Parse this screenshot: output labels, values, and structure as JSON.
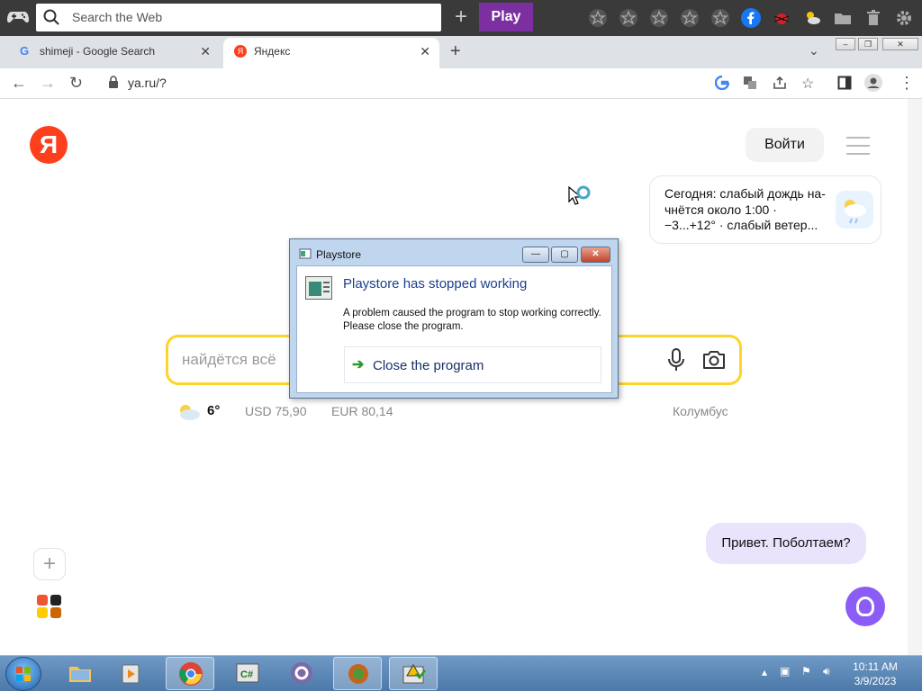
{
  "launcher": {
    "search_placeholder": "Search the Web",
    "new_label": "+",
    "play_label": "Play",
    "toolbar_icons": [
      "star-icon",
      "star-icon",
      "star-icon",
      "star-icon",
      "star-icon",
      "facebook-icon",
      "bug-icon",
      "weather-icon",
      "folder-icon",
      "trash-icon",
      "gear-icon"
    ]
  },
  "browser": {
    "tabs": [
      {
        "title": "shimeji - Google Search",
        "close": "✕",
        "favicon": "G"
      },
      {
        "title": "Яндекс",
        "close": "✕",
        "favicon": "Я"
      }
    ],
    "new_tab": "+",
    "tab_dropdown": "⌄",
    "url": "ya.ru/?"
  },
  "yandex": {
    "logo": "Я",
    "login_button": "Войти",
    "weather_card": "Сегодня: слабый дождь на-чнётся около 1:00 · −3...+12° · слабый ветер...",
    "search_placeholder": "найдётся всё",
    "weather_temp": "6°",
    "usd": "USD 75,90",
    "eur": "EUR 80,14",
    "kolumbus": "Колумбус",
    "alice_bubble": "Привет. Поболтаем?"
  },
  "dialog": {
    "title": "Playstore",
    "heading": "Playstore has stopped working",
    "message": "A problem caused the program to stop working correctly. Please close the program.",
    "action": "Close the program",
    "min": "—",
    "max": "▢",
    "close": "✕"
  },
  "taskbar": {
    "apps": [
      "explorer",
      "media-player",
      "chrome",
      "csharp",
      "qq",
      "stamp-app",
      "error-app"
    ],
    "time": "10:11 AM",
    "date": "3/9/2023"
  }
}
